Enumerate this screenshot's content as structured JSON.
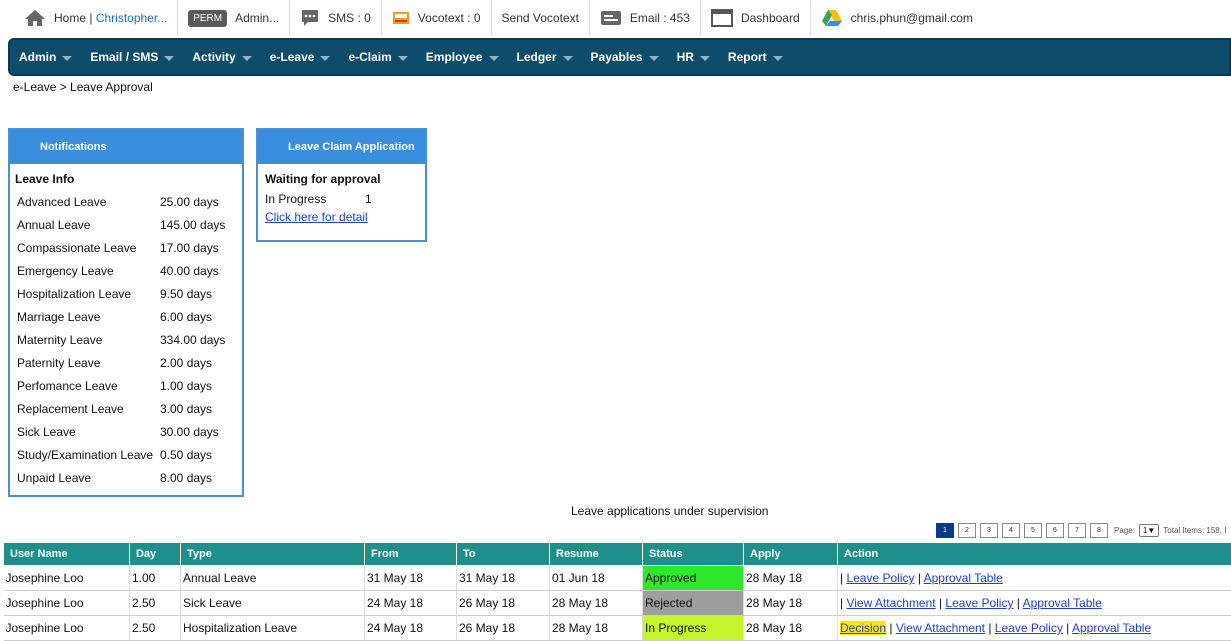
{
  "topbar": {
    "home_label": "Home |",
    "user_link": "Christopher...",
    "perm_badge": "PERM",
    "admin_label": "Admin...",
    "sms_label": "SMS : 0",
    "vocotext_label": "Vocotext : 0",
    "send_vocotext": "Send Vocotext",
    "email_label": "Email : 453",
    "dashboard_label": "Dashboard",
    "account_email": "chris.phun@gmail.com"
  },
  "menu": [
    "Admin",
    "Email / SMS",
    "Activity",
    "e-Leave",
    "e-Claim",
    "Employee",
    "Ledger",
    "Payables",
    "HR",
    "Report"
  ],
  "breadcrumb": "e-Leave > Leave Approval",
  "notifications": {
    "title": "Notifications",
    "subtitle": "Leave Info",
    "items": [
      {
        "name": "Advanced Leave",
        "days": "25.00 days"
      },
      {
        "name": "Annual Leave",
        "days": "145.00 days"
      },
      {
        "name": "Compassionate Leave",
        "days": "17.00 days"
      },
      {
        "name": "Emergency Leave",
        "days": "40.00 days"
      },
      {
        "name": "Hospitalization Leave",
        "days": "9.50 days"
      },
      {
        "name": "Marriage Leave",
        "days": "6.00 days"
      },
      {
        "name": "Maternity Leave",
        "days": "334.00 days"
      },
      {
        "name": "Paternity Leave",
        "days": "2.00 days"
      },
      {
        "name": "Perfomance Leave",
        "days": "1.00 days"
      },
      {
        "name": "Replacement Leave",
        "days": "3.00 days"
      },
      {
        "name": "Sick Leave",
        "days": "30.00 days"
      },
      {
        "name": "Study/Examination Leave",
        "days": "0.50 days"
      },
      {
        "name": "Unpaid Leave",
        "days": "8.00 days"
      }
    ]
  },
  "leave_claim": {
    "title": "Leave Claim Application",
    "subtitle": "Waiting for approval",
    "status_name": "In Progress",
    "status_count": "1",
    "detail_link": "Click here for detail"
  },
  "supervision": {
    "title": "Leave applications under supervision",
    "pages": [
      "1",
      "2",
      "3",
      "4",
      "5",
      "6",
      "7",
      "8"
    ],
    "page_label": "Page:",
    "page_select": "1",
    "total_label": "Total Items: 158, I"
  },
  "table": {
    "headers": [
      "User Name",
      "Day",
      "Type",
      "From",
      "To",
      "Resume",
      "Status",
      "Apply",
      "Action"
    ],
    "rows": [
      {
        "user": "Josephine Loo",
        "day": "1.00",
        "type": "Annual Leave",
        "from": "31 May 18",
        "to": "31 May 18",
        "resume": "01 Jun 18",
        "status": "Approved",
        "apply": "28 May 18"
      },
      {
        "user": "Josephine Loo",
        "day": "2.50",
        "type": "Sick Leave",
        "from": "24 May 18",
        "to": "26 May 18",
        "resume": "28 May 18",
        "status": "Rejected",
        "apply": "28 May 18"
      },
      {
        "user": "Josephine Loo",
        "day": "2.50",
        "type": "Hospitalization Leave",
        "from": "24 May 18",
        "to": "26 May 18",
        "resume": "28 May 18",
        "status": "In Progress",
        "apply": "28 May 18"
      }
    ],
    "actions": {
      "leave_policy": "Leave Policy",
      "approval_table": "Approval Table",
      "view_attachment": "View Attachment",
      "decision": "Decision"
    }
  },
  "colors": {
    "menubar": "#0d4c6b",
    "panel_header": "#3a8ede",
    "table_header": "#1f8f8b",
    "approved": "#2ee82a",
    "rejected": "#9e9e9e",
    "in_progress": "#c7f52c"
  }
}
